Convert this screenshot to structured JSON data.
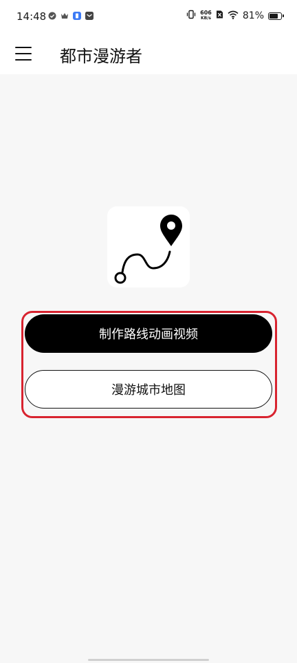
{
  "status_bar": {
    "time": "14:48",
    "net_speed_value": "606",
    "net_speed_unit": "KB/s",
    "battery_percent": "81%",
    "battery_level": 0.81
  },
  "app_bar": {
    "title": "都市漫游者"
  },
  "actions": {
    "make_video_label": "制作路线动画视频",
    "roam_map_label": "漫游城市地图"
  },
  "colors": {
    "primary_button": "#000000",
    "highlight": "#d8232f",
    "background": "#f7f7f7"
  },
  "icons": {
    "menu": "hamburger-menu-icon",
    "logo": "route-pin-icon"
  }
}
